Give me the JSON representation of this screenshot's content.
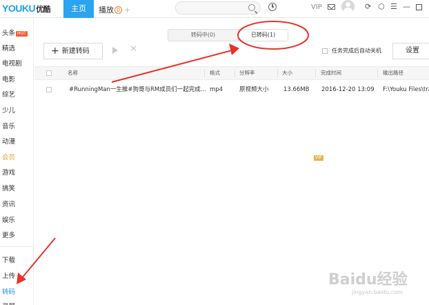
{
  "app": {
    "logo_latin": "YOUKU",
    "logo_cn": "优酷"
  },
  "topbar": {
    "tab_home": "主页",
    "tab_play": "播放",
    "tab_play_badge": "0",
    "tab_add": "+",
    "vip_label": "VIP"
  },
  "sidebar": {
    "items": [
      {
        "label": "头条",
        "badge": "HOT"
      },
      {
        "label": "精选"
      },
      {
        "label": "电视剧"
      },
      {
        "label": "电影"
      },
      {
        "label": "综艺"
      },
      {
        "label": "少儿"
      },
      {
        "label": "音乐"
      },
      {
        "label": "动漫"
      },
      {
        "label": "会员",
        "badge": "VIP"
      },
      {
        "label": "游戏"
      },
      {
        "label": "搞笑"
      },
      {
        "label": "资讯"
      },
      {
        "label": "娱乐"
      },
      {
        "label": "更多"
      }
    ],
    "tools": [
      {
        "label": "下载"
      },
      {
        "label": "上传"
      },
      {
        "label": "转码",
        "active": true
      },
      {
        "label": "录屏"
      }
    ]
  },
  "transcode": {
    "tab_in_progress": "转码中(0)",
    "tab_done": "已转码(1)",
    "new_button": "新建转码",
    "new_button_icon": "+",
    "shutdown_label": "任务完成后自动关机",
    "settings_button": "设置",
    "columns": [
      "名称",
      "格式",
      "分辨率",
      "大小",
      "完成时间",
      "输出路径"
    ],
    "rows": [
      {
        "name": "#RunningMan一生推#狗哥与RM成员们一起完成...",
        "format": "mp4",
        "resolution": "原视频大小",
        "size": "13.66MB",
        "finished": "2016-12-20 13:09",
        "path": "F:\\Youku Files\\tra"
      }
    ]
  },
  "watermark": {
    "main": "Baidu经验",
    "sub": "jingyan.baidu.com"
  },
  "colors": {
    "accent": "#2aa3f0",
    "annotation": "#e8322b",
    "hot": "#f25b3a",
    "vip": "#e6b34a"
  }
}
